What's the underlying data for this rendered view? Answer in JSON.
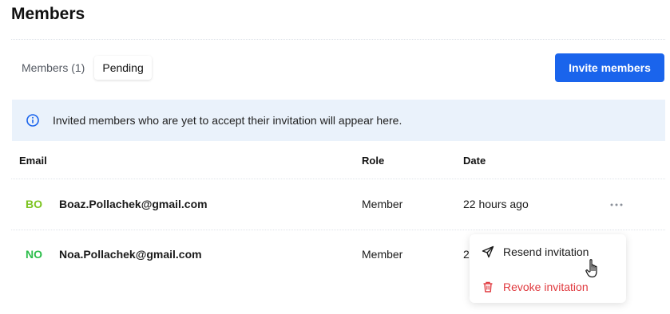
{
  "page": {
    "title": "Members"
  },
  "tabs": [
    {
      "label": "Members (1)",
      "active": false
    },
    {
      "label": "Pending",
      "active": true
    }
  ],
  "invite_button": "Invite members",
  "info_banner": {
    "icon": "info-icon",
    "text": "Invited members who are yet to accept their invitation will appear here."
  },
  "table": {
    "headers": {
      "email": "Email",
      "role": "Role",
      "date": "Date"
    },
    "rows": [
      {
        "initials": "BO",
        "initials_color": "#7cc420",
        "email": "Boaz.Pollachek@gmail.com",
        "role": "Member",
        "date": "22 hours ago"
      },
      {
        "initials": "NO",
        "initials_color": "#2bbd4a",
        "email": "Noa.Pollachek@gmail.com",
        "role": "Member",
        "date": "2"
      }
    ]
  },
  "row_actions_menu": {
    "items": [
      {
        "label": "Resend invitation",
        "icon": "send-icon",
        "color": "#1a1a1a"
      },
      {
        "label": "Revoke invitation",
        "icon": "trash-icon",
        "color": "#e0393e"
      }
    ]
  },
  "colors": {
    "accent": "#1a64ec",
    "banner_bg": "#eaf2fb",
    "danger": "#e0393e"
  }
}
